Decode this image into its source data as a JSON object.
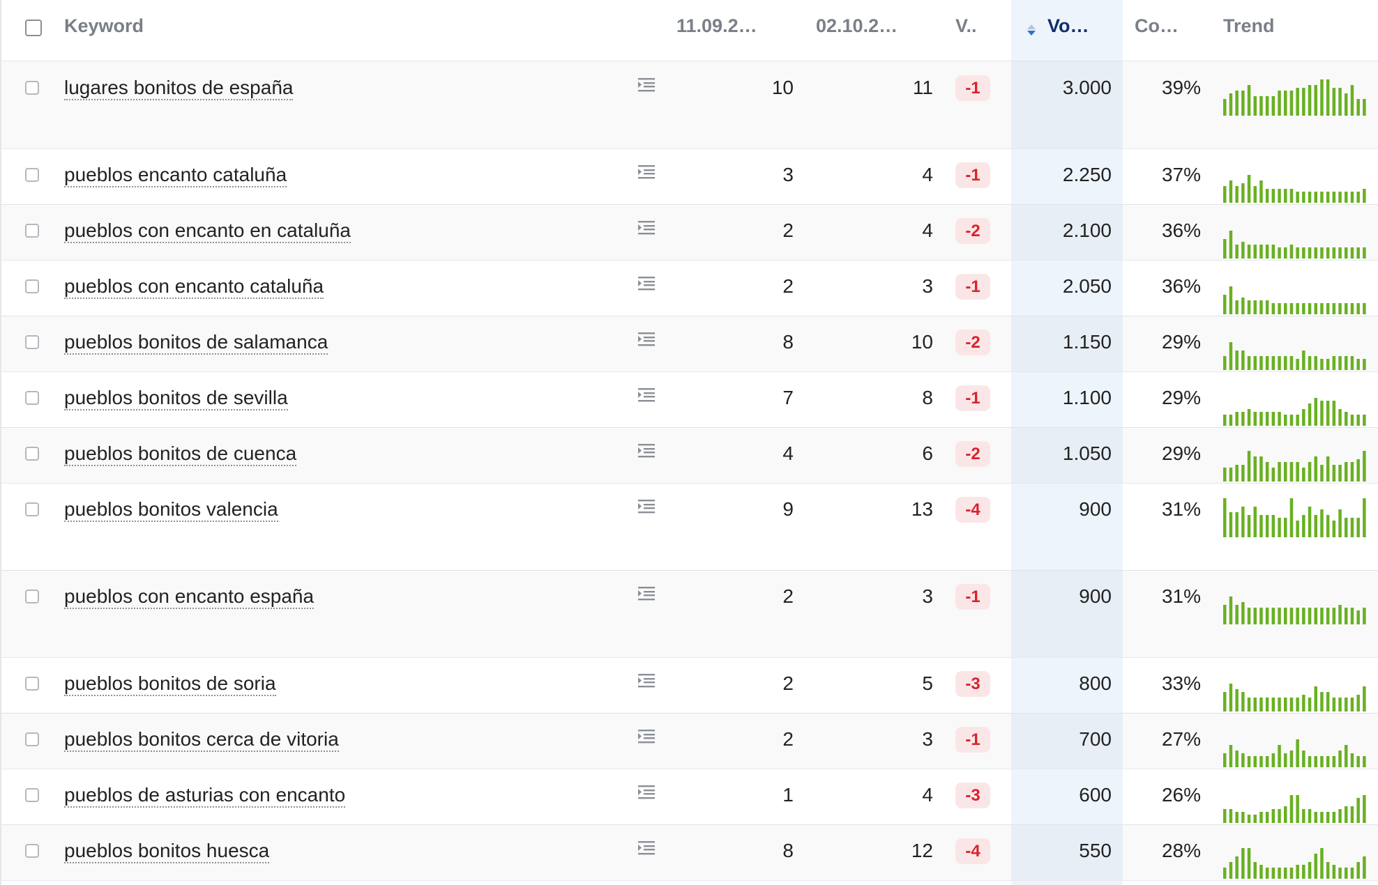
{
  "header": {
    "keyword": "Keyword",
    "date1": "11.09.2…",
    "date2": "02.10.2…",
    "change": "V..",
    "volume": "Vo…",
    "competition": "Co…",
    "trend": "Trend"
  },
  "colors": {
    "trend_bar": "#6ab023",
    "badge_bg": "#fbe6e7",
    "badge_text": "#d8232e",
    "volume_highlight": "#eef4fb"
  },
  "icons": {
    "serp": "serp-preview-icon",
    "sort": "sort-icon"
  },
  "rows": [
    {
      "keyword": "lugares bonitos de españa",
      "d1": "10",
      "d2": "11",
      "change": "-1",
      "volume": "3.000",
      "comp": "39%",
      "trend": [
        6,
        8,
        9,
        9,
        11,
        7,
        7,
        7,
        7,
        9,
        9,
        9,
        10,
        10,
        11,
        11,
        13,
        13,
        10,
        10,
        8,
        11,
        6,
        6
      ],
      "tall": true
    },
    {
      "keyword": "pueblos encanto cataluña",
      "d1": "3",
      "d2": "4",
      "change": "-1",
      "volume": "2.250",
      "comp": "37%",
      "trend": [
        6,
        8,
        6,
        7,
        10,
        6,
        8,
        5,
        5,
        5,
        5,
        5,
        4,
        4,
        4,
        4,
        4,
        4,
        4,
        4,
        4,
        4,
        4,
        5
      ],
      "tall": false
    },
    {
      "keyword": "pueblos con encanto en cataluña",
      "d1": "2",
      "d2": "4",
      "change": "-2",
      "volume": "2.100",
      "comp": "36%",
      "trend": [
        7,
        10,
        5,
        6,
        5,
        5,
        5,
        5,
        5,
        4,
        4,
        5,
        4,
        4,
        4,
        4,
        4,
        4,
        4,
        4,
        4,
        4,
        4,
        4
      ],
      "tall": false
    },
    {
      "keyword": "pueblos con encanto cataluña",
      "d1": "2",
      "d2": "3",
      "change": "-1",
      "volume": "2.050",
      "comp": "36%",
      "trend": [
        7,
        10,
        5,
        6,
        5,
        5,
        5,
        5,
        4,
        4,
        4,
        4,
        4,
        4,
        4,
        4,
        4,
        4,
        4,
        4,
        4,
        4,
        4,
        4
      ],
      "tall": false
    },
    {
      "keyword": "pueblos bonitos de salamanca",
      "d1": "8",
      "d2": "10",
      "change": "-2",
      "volume": "1.150",
      "comp": "29%",
      "trend": [
        5,
        10,
        7,
        7,
        5,
        5,
        5,
        5,
        5,
        5,
        5,
        5,
        4,
        7,
        5,
        5,
        4,
        4,
        5,
        5,
        5,
        5,
        4,
        4
      ],
      "tall": false
    },
    {
      "keyword": "pueblos bonitos de sevilla",
      "d1": "7",
      "d2": "8",
      "change": "-1",
      "volume": "1.100",
      "comp": "29%",
      "trend": [
        4,
        4,
        5,
        5,
        6,
        5,
        5,
        5,
        5,
        5,
        4,
        4,
        4,
        6,
        8,
        10,
        9,
        9,
        9,
        6,
        5,
        4,
        4,
        4
      ],
      "tall": false
    },
    {
      "keyword": "pueblos bonitos de cuenca",
      "d1": "4",
      "d2": "6",
      "change": "-2",
      "volume": "1.050",
      "comp": "29%",
      "trend": [
        5,
        5,
        6,
        6,
        11,
        9,
        9,
        7,
        5,
        7,
        7,
        7,
        7,
        5,
        7,
        9,
        6,
        9,
        6,
        6,
        7,
        7,
        8,
        11
      ],
      "tall": false
    },
    {
      "keyword": "pueblos bonitos valencia",
      "d1": "9",
      "d2": "13",
      "change": "-4",
      "volume": "900",
      "comp": "31%",
      "trend": [
        14,
        9,
        9,
        11,
        8,
        11,
        8,
        8,
        8,
        7,
        7,
        14,
        6,
        8,
        11,
        8,
        10,
        8,
        6,
        10,
        7,
        7,
        7,
        14
      ],
      "tall": true
    },
    {
      "keyword": "pueblos con encanto españa",
      "d1": "2",
      "d2": "3",
      "change": "-1",
      "volume": "900",
      "comp": "31%",
      "trend": [
        7,
        10,
        7,
        8,
        6,
        6,
        6,
        6,
        6,
        6,
        6,
        6,
        6,
        6,
        6,
        6,
        6,
        6,
        6,
        7,
        6,
        6,
        5,
        6
      ],
      "tall": true
    },
    {
      "keyword": "pueblos bonitos de soria",
      "d1": "2",
      "d2": "5",
      "change": "-3",
      "volume": "800",
      "comp": "33%",
      "trend": [
        7,
        10,
        8,
        7,
        5,
        5,
        5,
        5,
        5,
        5,
        5,
        5,
        5,
        6,
        5,
        9,
        7,
        7,
        5,
        5,
        5,
        5,
        6,
        9
      ],
      "tall": false
    },
    {
      "keyword": "pueblos bonitos cerca de vitoria",
      "d1": "2",
      "d2": "3",
      "change": "-1",
      "volume": "700",
      "comp": "27%",
      "trend": [
        5,
        8,
        6,
        5,
        4,
        4,
        4,
        4,
        5,
        8,
        5,
        6,
        10,
        6,
        4,
        4,
        4,
        4,
        4,
        6,
        8,
        5,
        4,
        4
      ],
      "tall": false
    },
    {
      "keyword": "pueblos de asturias con encanto",
      "d1": "1",
      "d2": "4",
      "change": "-3",
      "volume": "600",
      "comp": "26%",
      "trend": [
        5,
        5,
        4,
        4,
        3,
        3,
        4,
        4,
        5,
        5,
        6,
        10,
        10,
        5,
        5,
        4,
        4,
        4,
        4,
        5,
        6,
        6,
        9,
        10
      ],
      "tall": false
    },
    {
      "keyword": "pueblos bonitos huesca",
      "d1": "8",
      "d2": "12",
      "change": "-4",
      "volume": "550",
      "comp": "28%",
      "trend": [
        4,
        6,
        8,
        11,
        11,
        6,
        5,
        4,
        4,
        4,
        4,
        4,
        5,
        5,
        6,
        9,
        11,
        6,
        5,
        4,
        4,
        4,
        6,
        8
      ],
      "tall": false
    }
  ]
}
